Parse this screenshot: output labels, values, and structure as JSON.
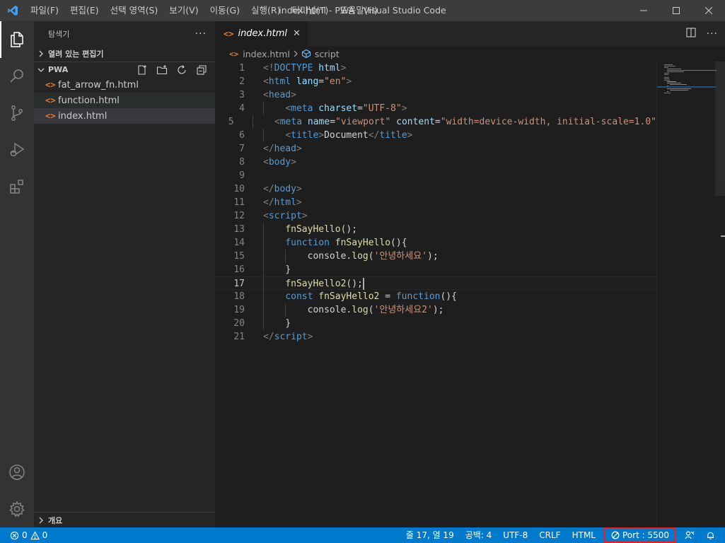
{
  "titlebar": {
    "menu": [
      "파일(F)",
      "편집(E)",
      "선택 영역(S)",
      "보기(V)",
      "이동(G)",
      "실행(R)",
      "터미널(T)",
      "도움말(H)"
    ],
    "title": "index.html - PWA - Visual Studio Code"
  },
  "activitybar": {
    "items": [
      "explorer-icon",
      "search-icon",
      "source-control-icon",
      "run-debug-icon",
      "extensions-icon"
    ],
    "bottom": [
      "account-icon",
      "settings-gear-icon"
    ]
  },
  "sidebar": {
    "title": "탐색기",
    "open_editors": "열려 있는 편집기",
    "folder": "PWA",
    "files": [
      "fat_arrow_fn.html",
      "function.html",
      "index.html"
    ],
    "outline": "개요"
  },
  "editor": {
    "tab": {
      "icon": "<>",
      "label": "index.html",
      "close": "✕"
    },
    "breadcrumb": {
      "file": "index.html",
      "symbol": "script"
    },
    "line_numbers": [
      "1",
      "2",
      "3",
      "4",
      "5",
      "6",
      "7",
      "8",
      "9",
      "10",
      "11",
      "12",
      "13",
      "14",
      "15",
      "16",
      "17",
      "18",
      "19",
      "20",
      "21"
    ]
  },
  "statusbar": {
    "errors": "0",
    "warnings": "0",
    "position": "줄 17, 열 19",
    "spaces": "공백: 4",
    "encoding": "UTF-8",
    "eol": "CRLF",
    "language": "HTML",
    "port": "Port : 5500"
  },
  "colors": {
    "accent": "#007acc",
    "highlight_box": "#ff1a1a",
    "html_file_icon": "#e37933"
  }
}
